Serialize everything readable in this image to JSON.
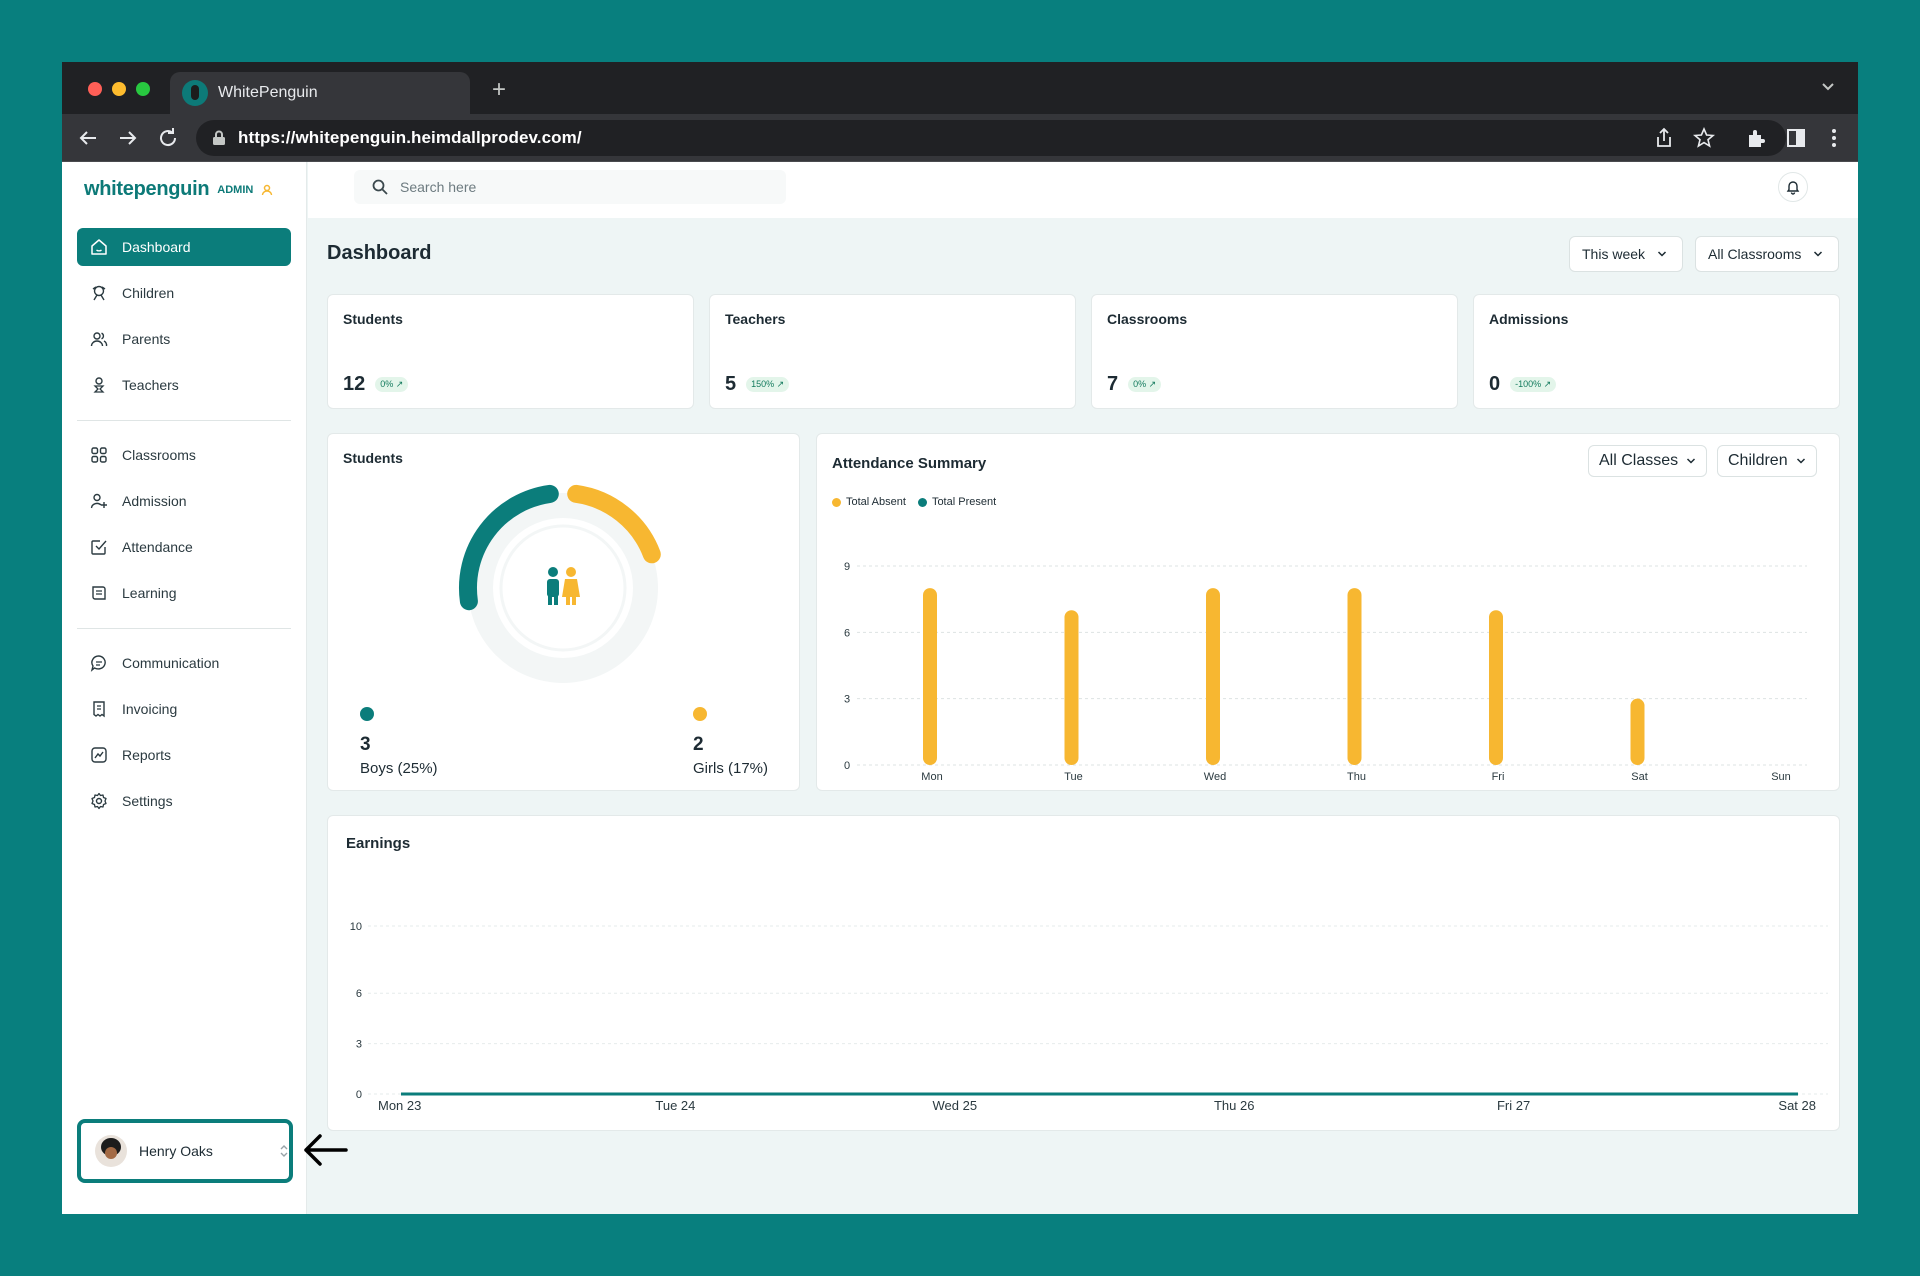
{
  "browser": {
    "tab_title": "WhitePenguin",
    "url": "https://whitepenguin.heimdallprodev.com/"
  },
  "brand": {
    "name": "whitepenguin",
    "badge": "ADMIN"
  },
  "search": {
    "placeholder": "Search here"
  },
  "sidebar": {
    "items": [
      {
        "label": "Dashboard",
        "icon": "home-icon",
        "active": true
      },
      {
        "label": "Children",
        "icon": "child-icon"
      },
      {
        "label": "Parents",
        "icon": "users-icon"
      },
      {
        "label": "Teachers",
        "icon": "teacher-icon"
      },
      {
        "label": "Classrooms",
        "icon": "grid-icon"
      },
      {
        "label": "Admission",
        "icon": "user-plus-icon"
      },
      {
        "label": "Attendance",
        "icon": "check-square-icon"
      },
      {
        "label": "Learning",
        "icon": "book-icon"
      },
      {
        "label": "Communication",
        "icon": "chat-icon"
      },
      {
        "label": "Invoicing",
        "icon": "invoice-icon"
      },
      {
        "label": "Reports",
        "icon": "report-icon"
      },
      {
        "label": "Settings",
        "icon": "gear-icon"
      }
    ]
  },
  "user": {
    "name": "Henry Oaks"
  },
  "page": {
    "title": "Dashboard",
    "period_filter": "This week",
    "classroom_filter": "All Classrooms"
  },
  "stats": [
    {
      "label": "Students",
      "value": "12",
      "change": "0% ↗"
    },
    {
      "label": "Teachers",
      "value": "5",
      "change": "150% ↗"
    },
    {
      "label": "Classrooms",
      "value": "7",
      "change": "0% ↗"
    },
    {
      "label": "Admissions",
      "value": "0",
      "change": "-100% ↗"
    }
  ],
  "students_card": {
    "title": "Students",
    "boys": {
      "count": "3",
      "label": "Boys (25%)",
      "color": "#0b7d7b",
      "fraction": 0.25
    },
    "girls": {
      "count": "2",
      "label": "Girls (17%)",
      "color": "#f7b731",
      "fraction": 0.17
    }
  },
  "attendance": {
    "title": "Attendance Summary",
    "class_filter": "All Classes",
    "type_filter": "Children",
    "legend": [
      {
        "label": "Total Absent",
        "color": "#f7b731"
      },
      {
        "label": "Total Present",
        "color": "#0b7d7b"
      }
    ]
  },
  "earnings": {
    "title": "Earnings"
  },
  "colors": {
    "accent": "#0b7d7b",
    "yellow": "#f7b731",
    "frame": "#087f7e"
  },
  "chart_data": [
    {
      "type": "bar",
      "categories": [
        "Mon",
        "Tue",
        "Wed",
        "Thu",
        "Fri",
        "Sat",
        "Sun"
      ],
      "series": [
        {
          "name": "Total Absent",
          "values": [
            8,
            7,
            8,
            8,
            7,
            3,
            0
          ]
        },
        {
          "name": "Total Present",
          "values": [
            0,
            0,
            0,
            0,
            0,
            0,
            0
          ]
        }
      ],
      "yticks": [
        0,
        3,
        6,
        9
      ],
      "ylim": [
        0,
        9
      ],
      "grid": true,
      "legend": "top-left"
    },
    {
      "type": "line",
      "title": "Earnings",
      "categories": [
        "Mon 23",
        "Tue 24",
        "Wed 25",
        "Thu 26",
        "Fri 27",
        "Sat 28"
      ],
      "values": [
        0,
        0,
        0,
        0,
        0,
        0
      ],
      "yticks": [
        0,
        3,
        6,
        10
      ],
      "ylim": [
        0,
        10
      ],
      "grid": true
    }
  ]
}
